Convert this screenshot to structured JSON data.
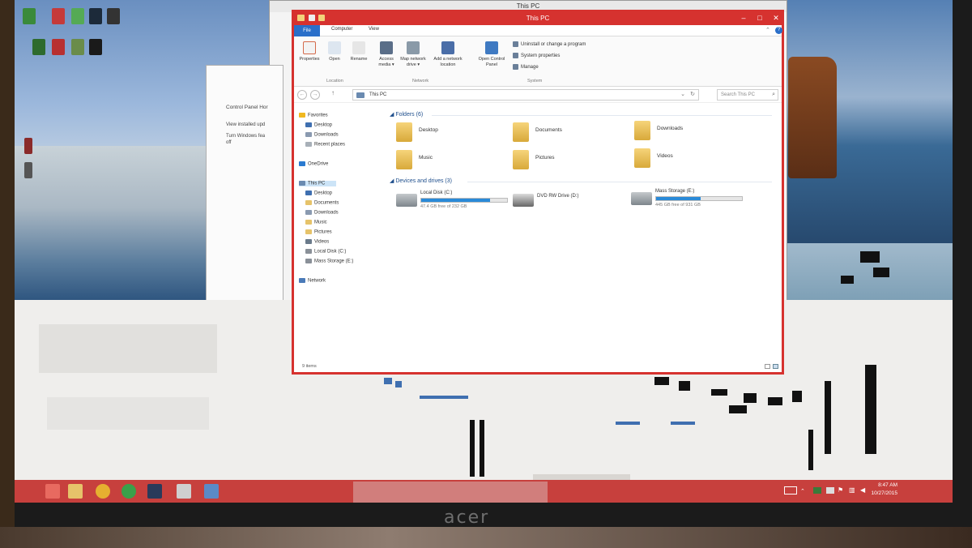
{
  "back_window": {
    "title": "This PC"
  },
  "control_panel_window": {
    "heading": "Control Panel Hor",
    "items": [
      "View installed upd",
      "Turn Windows fea",
      "off"
    ]
  },
  "explorer": {
    "title": "This PC",
    "ribbon_tabs": {
      "file": "File",
      "computer": "Computer",
      "view": "View"
    },
    "ribbon": {
      "location_buttons": [
        "Properties",
        "Open",
        "Rename"
      ],
      "network_buttons": [
        {
          "line1": "Access",
          "line2": "media ▾"
        },
        {
          "line1": "Map network",
          "line2": "drive ▾"
        },
        {
          "line1": "Add a network",
          "line2": "location"
        }
      ],
      "system_button": {
        "line1": "Open Control",
        "line2": "Panel"
      },
      "system_links": [
        "Uninstall or change a program",
        "System properties",
        "Manage"
      ],
      "groups": {
        "location": "Location",
        "network": "Network",
        "system": "System"
      }
    },
    "address": {
      "path": "This PC",
      "search_placeholder": "Search This PC"
    },
    "nav_pane": {
      "favorites": [
        "Favorites",
        "Desktop",
        "Downloads",
        "Recent places"
      ],
      "onedrive": "OneDrive",
      "this_pc": [
        "This PC",
        "Desktop",
        "Documents",
        "Downloads",
        "Music",
        "Pictures",
        "Videos",
        "Local Disk (C:)",
        "Mass Storage (E:)"
      ],
      "network": "Network"
    },
    "folders_header": "Folders (6)",
    "folders": [
      "Desktop",
      "Documents",
      "Downloads",
      "Music",
      "Pictures",
      "Videos"
    ],
    "devices_header": "Devices and drives (3)",
    "drives": [
      {
        "name": "Local Disk (C:)",
        "free": "47.4 GB free of 232 GB",
        "used_fraction": 0.8
      },
      {
        "name": "DVD RW Drive (D:)",
        "free": "",
        "used_fraction": null
      },
      {
        "name": "Mass Storage (E:)",
        "free": "445 GB free of 931 GB",
        "used_fraction": 0.52
      }
    ],
    "status": "9 items"
  },
  "taskbar": {
    "time": "8:47 AM",
    "date": "10/27/2015"
  },
  "monitor_brand": "acer",
  "colors": {
    "accent_red": "#d6322f",
    "taskbar_red": "#c7403d",
    "file_tab_blue": "#2a6fc9",
    "drive_bar_blue": "#2a8ad8"
  }
}
